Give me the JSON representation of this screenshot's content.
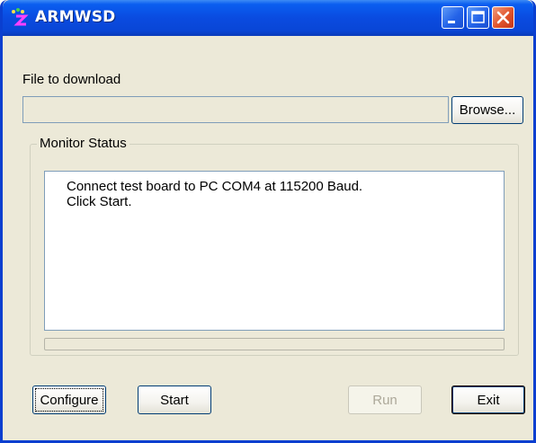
{
  "window": {
    "title": "ARMWSD",
    "controls": [
      "minimize-icon",
      "maximize-icon",
      "close-icon"
    ],
    "colors": {
      "titlebar": "#0a4be0",
      "close": "#e0522a",
      "face": "#ece9d8"
    }
  },
  "file": {
    "label": "File to download",
    "value": "",
    "browse_label": "Browse..."
  },
  "monitor": {
    "group_label": "Monitor Status",
    "lines": [
      "Connect test board to PC COM4 at 115200 Baud.",
      "Click Start."
    ],
    "progress": 0
  },
  "buttons": {
    "configure": "Configure",
    "start": "Start",
    "run": "Run",
    "exit": "Exit"
  }
}
